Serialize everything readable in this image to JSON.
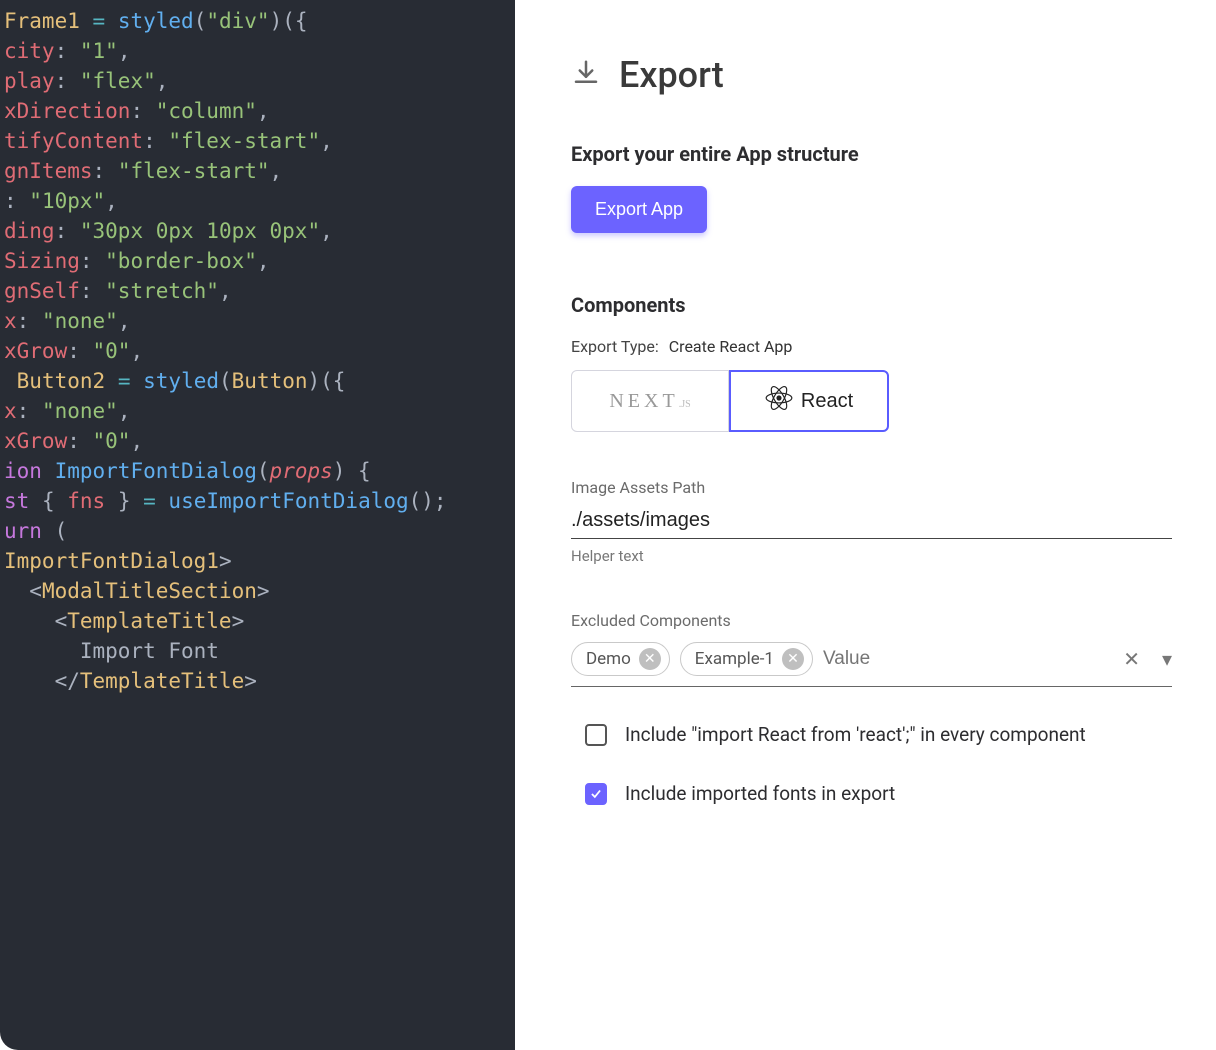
{
  "code": {
    "lines": [
      [
        [
          "c-yellow",
          "Frame1"
        ],
        [
          "c-gray",
          " "
        ],
        [
          "c-aqua",
          "="
        ],
        [
          "c-gray",
          " "
        ],
        [
          "c-blue",
          "styled"
        ],
        [
          "c-gray",
          "("
        ],
        [
          "c-green",
          "\"div\""
        ],
        [
          "c-gray",
          ")({"
        ]
      ],
      [
        [
          "c-red",
          "city"
        ],
        [
          "c-gray",
          ": "
        ],
        [
          "c-green",
          "\"1\""
        ],
        [
          "c-gray",
          ","
        ]
      ],
      [
        [
          "c-red",
          "play"
        ],
        [
          "c-gray",
          ": "
        ],
        [
          "c-green",
          "\"flex\""
        ],
        [
          "c-gray",
          ","
        ]
      ],
      [
        [
          "c-red",
          "xDirection"
        ],
        [
          "c-gray",
          ": "
        ],
        [
          "c-green",
          "\"column\""
        ],
        [
          "c-gray",
          ","
        ]
      ],
      [
        [
          "c-red",
          "tifyContent"
        ],
        [
          "c-gray",
          ": "
        ],
        [
          "c-green",
          "\"flex-start\""
        ],
        [
          "c-gray",
          ","
        ]
      ],
      [
        [
          "c-red",
          "gnItems"
        ],
        [
          "c-gray",
          ": "
        ],
        [
          "c-green",
          "\"flex-start\""
        ],
        [
          "c-gray",
          ","
        ]
      ],
      [
        [
          "c-gray",
          ": "
        ],
        [
          "c-green",
          "\"10px\""
        ],
        [
          "c-gray",
          ","
        ]
      ],
      [
        [
          "c-red",
          "ding"
        ],
        [
          "c-gray",
          ": "
        ],
        [
          "c-green",
          "\"30px 0px 10px 0px\""
        ],
        [
          "c-gray",
          ","
        ]
      ],
      [
        [
          "c-red",
          "Sizing"
        ],
        [
          "c-gray",
          ": "
        ],
        [
          "c-green",
          "\"border-box\""
        ],
        [
          "c-gray",
          ","
        ]
      ],
      [
        [
          "c-red",
          "gnSelf"
        ],
        [
          "c-gray",
          ": "
        ],
        [
          "c-green",
          "\"stretch\""
        ],
        [
          "c-gray",
          ","
        ]
      ],
      [
        [
          "c-red",
          "x"
        ],
        [
          "c-gray",
          ": "
        ],
        [
          "c-green",
          "\"none\""
        ],
        [
          "c-gray",
          ","
        ]
      ],
      [
        [
          "c-red",
          "xGrow"
        ],
        [
          "c-gray",
          ": "
        ],
        [
          "c-green",
          "\"0\""
        ],
        [
          "c-gray",
          ","
        ]
      ],
      [
        [
          "c-gray",
          ""
        ]
      ],
      [
        [
          "c-gray",
          ""
        ]
      ],
      [
        [
          "c-gray",
          " "
        ],
        [
          "c-yellow",
          "Button2"
        ],
        [
          "c-gray",
          " "
        ],
        [
          "c-aqua",
          "="
        ],
        [
          "c-gray",
          " "
        ],
        [
          "c-blue",
          "styled"
        ],
        [
          "c-gray",
          "("
        ],
        [
          "c-yellow",
          "Button"
        ],
        [
          "c-gray",
          ")({"
        ]
      ],
      [
        [
          "c-red",
          "x"
        ],
        [
          "c-gray",
          ": "
        ],
        [
          "c-green",
          "\"none\""
        ],
        [
          "c-gray",
          ","
        ]
      ],
      [
        [
          "c-red",
          "xGrow"
        ],
        [
          "c-gray",
          ": "
        ],
        [
          "c-green",
          "\"0\""
        ],
        [
          "c-gray",
          ","
        ]
      ],
      [
        [
          "c-gray",
          ""
        ]
      ],
      [
        [
          "c-gray",
          ""
        ]
      ],
      [
        [
          "c-purple",
          "ion"
        ],
        [
          "c-gray",
          " "
        ],
        [
          "c-blue",
          "ImportFontDialog"
        ],
        [
          "c-gray",
          "("
        ],
        [
          "c-red c-ital",
          "props"
        ],
        [
          "c-gray",
          ") {"
        ]
      ],
      [
        [
          "c-purple",
          "st"
        ],
        [
          "c-gray",
          " { "
        ],
        [
          "c-red",
          "fns"
        ],
        [
          "c-gray",
          " } "
        ],
        [
          "c-aqua",
          "="
        ],
        [
          "c-gray",
          " "
        ],
        [
          "c-blue",
          "useImportFontDialog"
        ],
        [
          "c-gray",
          "();"
        ]
      ],
      [
        [
          "c-gray",
          ""
        ]
      ],
      [
        [
          "c-purple",
          "urn"
        ],
        [
          "c-gray",
          " ("
        ]
      ],
      [
        [
          "jsx-brkt",
          ""
        ],
        [
          "jsx-tag",
          "ImportFontDialog1"
        ],
        [
          "jsx-brkt",
          ">"
        ]
      ],
      [
        [
          "jsx-brkt",
          "  <"
        ],
        [
          "jsx-tag",
          "ModalTitleSection"
        ],
        [
          "jsx-brkt",
          ">"
        ]
      ],
      [
        [
          "jsx-brkt",
          "    <"
        ],
        [
          "jsx-tag",
          "TemplateTitle"
        ],
        [
          "jsx-brkt",
          ">"
        ]
      ],
      [
        [
          "c-gray",
          "      Import Font"
        ]
      ],
      [
        [
          "jsx-brkt",
          "    </"
        ],
        [
          "jsx-tag",
          "TemplateTitle"
        ],
        [
          "jsx-brkt",
          ">"
        ]
      ]
    ]
  },
  "panel": {
    "title": "Export",
    "export_section_title": "Export your entire App structure",
    "export_button": "Export App",
    "components_title": "Components",
    "export_type_label": "Export Type:",
    "export_type_value": "Create React App",
    "framework_options": {
      "next": "NEXT",
      "next_suffix": ".JS",
      "react": "React"
    },
    "image_path_label": "Image Assets Path",
    "image_path_value": "./assets/images",
    "helper_text": "Helper text",
    "excluded_label": "Excluded Components",
    "chips": [
      "Demo",
      "Example-1"
    ],
    "chips_placeholder": "Value",
    "checkbox1_label": "Include \"import React from 'react';\" in every component",
    "checkbox1_checked": false,
    "checkbox2_label": "Include imported fonts in export",
    "checkbox2_checked": true
  }
}
